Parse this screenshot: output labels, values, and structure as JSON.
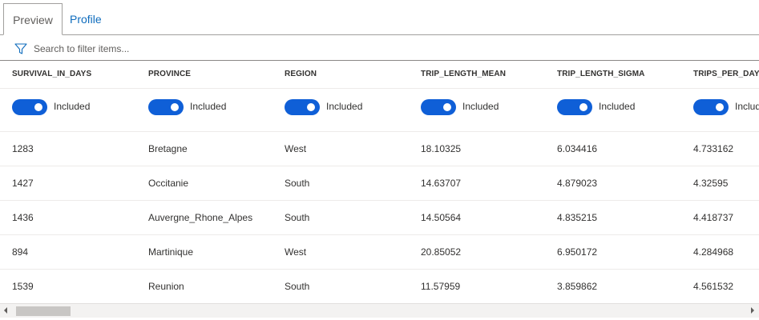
{
  "tabs": [
    {
      "label": "Preview",
      "active": true
    },
    {
      "label": "Profile",
      "active": false
    }
  ],
  "search": {
    "placeholder": "Search to filter items...",
    "value": ""
  },
  "toggle_label": "Included",
  "columns": [
    {
      "header": "SURVIVAL_IN_DAYS",
      "included": true
    },
    {
      "header": "PROVINCE",
      "included": true
    },
    {
      "header": "REGION",
      "included": true
    },
    {
      "header": "TRIP_LENGTH_MEAN",
      "included": true
    },
    {
      "header": "TRIP_LENGTH_SIGMA",
      "included": true
    },
    {
      "header": "TRIPS_PER_DAY_M",
      "included": true
    }
  ],
  "rows": [
    [
      "1283",
      "Bretagne",
      "West",
      "18.10325",
      "6.034416",
      "4.733162"
    ],
    [
      "1427",
      "Occitanie",
      "South",
      "14.63707",
      "4.879023",
      "4.32595"
    ],
    [
      "1436",
      "Auvergne_Rhone_Alpes",
      "South",
      "14.50564",
      "4.835215",
      "4.418737"
    ],
    [
      "894",
      "Martinique",
      "West",
      "20.85052",
      "6.950172",
      "4.284968"
    ],
    [
      "1539",
      "Reunion",
      "South",
      "11.57959",
      "3.859862",
      "4.561532"
    ]
  ],
  "colors": {
    "accent": "#0f5fd7",
    "tab_link": "#0f6cbd"
  }
}
